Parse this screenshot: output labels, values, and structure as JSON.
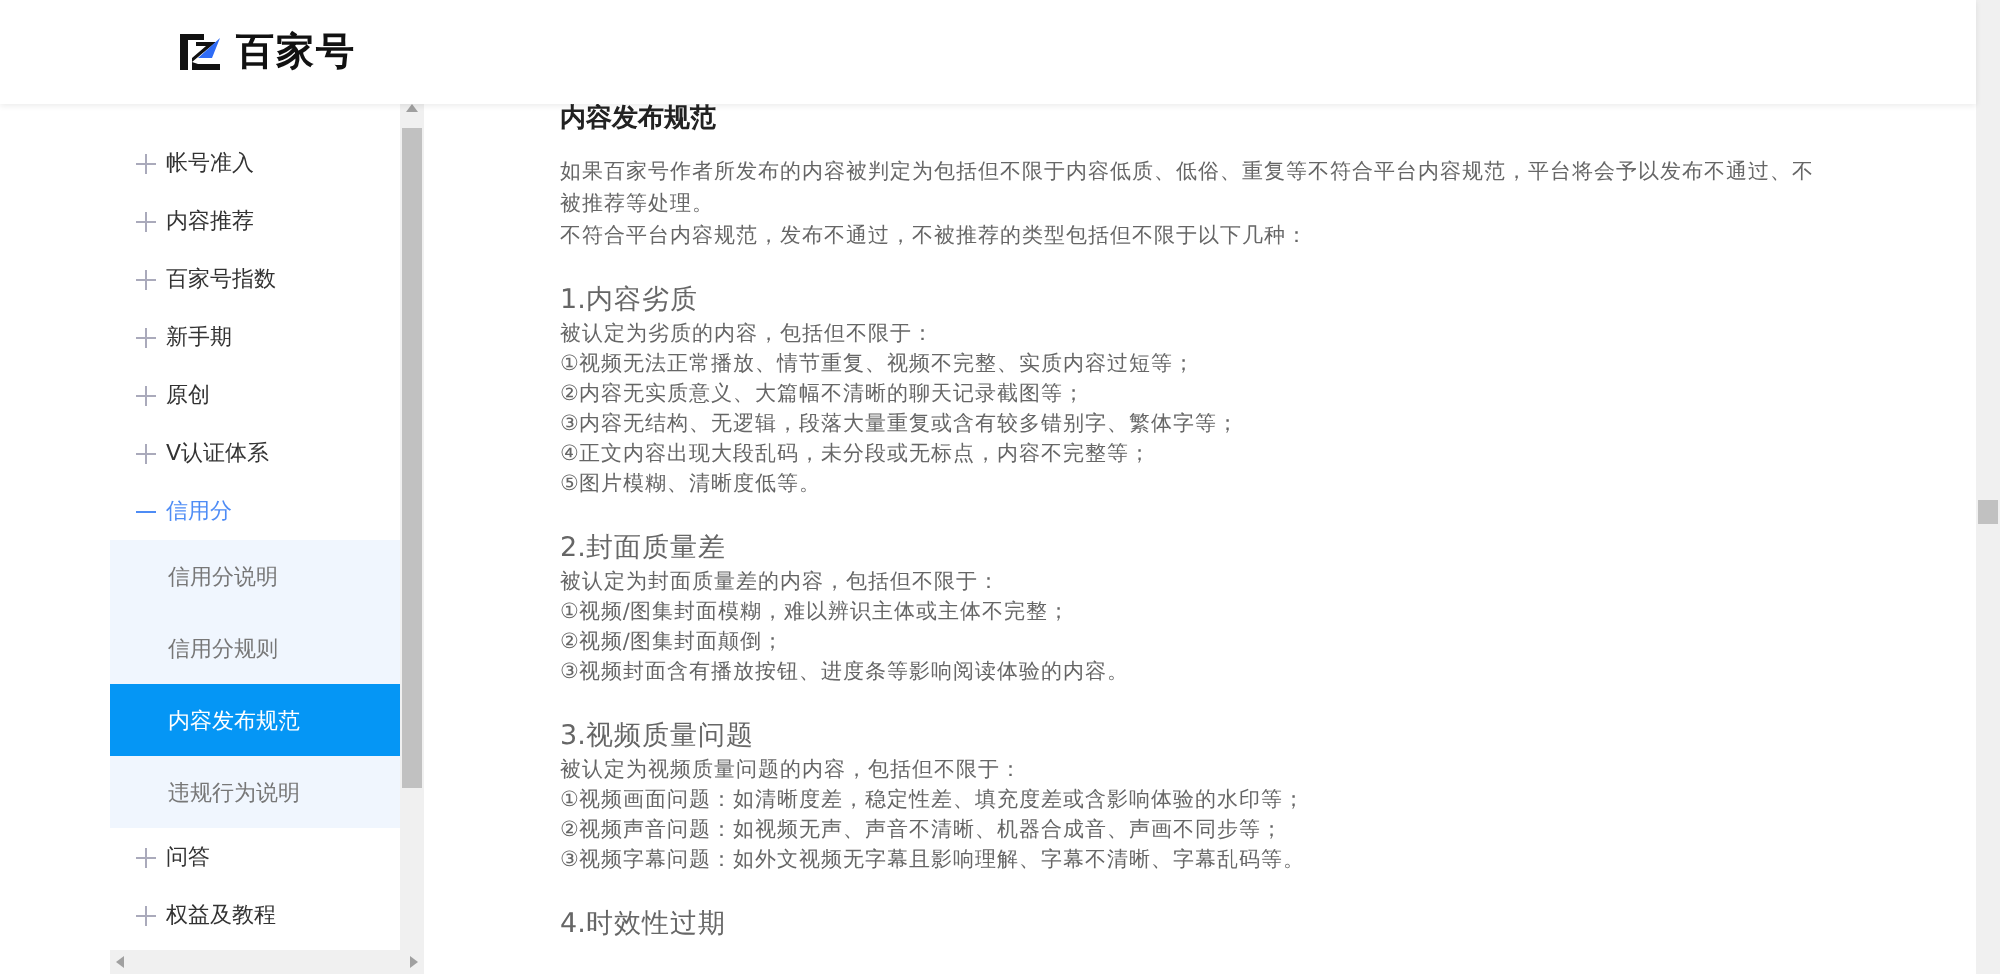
{
  "header": {
    "logo_text": "百家号"
  },
  "sidebar": {
    "items": [
      {
        "label": "帐号准入",
        "expanded": false
      },
      {
        "label": "内容推荐",
        "expanded": false
      },
      {
        "label": "百家号指数",
        "expanded": false
      },
      {
        "label": "新手期",
        "expanded": false
      },
      {
        "label": "原创",
        "expanded": false
      },
      {
        "label": "V认证体系",
        "expanded": false
      },
      {
        "label": "信用分",
        "expanded": true,
        "children": [
          {
            "label": "信用分说明",
            "selected": false
          },
          {
            "label": "信用分规则",
            "selected": false
          },
          {
            "label": "内容发布规范",
            "selected": true
          },
          {
            "label": "违规行为说明",
            "selected": false
          }
        ]
      },
      {
        "label": "问答",
        "expanded": false
      },
      {
        "label": "权益及教程",
        "expanded": false
      }
    ]
  },
  "article": {
    "title": "内容发布规范",
    "intro": [
      "如果百家号作者所发布的内容被判定为包括但不限于内容低质、低俗、重复等不符合平台内容规范，平台将会予以发布不通过、不被推荐等处理。",
      "不符合平台内容规范，发布不通过，不被推荐的类型包括但不限于以下几种："
    ],
    "sections": [
      {
        "heading": "1.内容劣质",
        "lines": [
          "被认定为劣质的内容，包括但不限于：",
          "①视频无法正常播放、情节重复、视频不完整、实质内容过短等；",
          "②内容无实质意义、大篇幅不清晰的聊天记录截图等；",
          "③内容无结构、无逻辑，段落大量重复或含有较多错别字、繁体字等；",
          "④正文内容出现大段乱码，未分段或无标点，内容不完整等；",
          "⑤图片模糊、清晰度低等。"
        ]
      },
      {
        "heading": "2.封面质量差",
        "lines": [
          "被认定为封面质量差的内容，包括但不限于：",
          "①视频/图集封面模糊，难以辨识主体或主体不完整；",
          "②视频/图集封面颠倒；",
          "③视频封面含有播放按钮、进度条等影响阅读体验的内容。"
        ]
      },
      {
        "heading": "3.视频质量问题",
        "lines": [
          "被认定为视频质量问题的内容，包括但不限于：",
          "①视频画面问题：如清晰度差，稳定性差、填充度差或含影响体验的水印等；",
          "②视频声音问题：如视频无声、声音不清晰、机器合成音、声画不同步等；",
          "③视频字幕问题：如外文视频无字幕且影响理解、字幕不清晰、字幕乱码等。"
        ]
      },
      {
        "heading": "4.时效性过期"
      }
    ]
  }
}
